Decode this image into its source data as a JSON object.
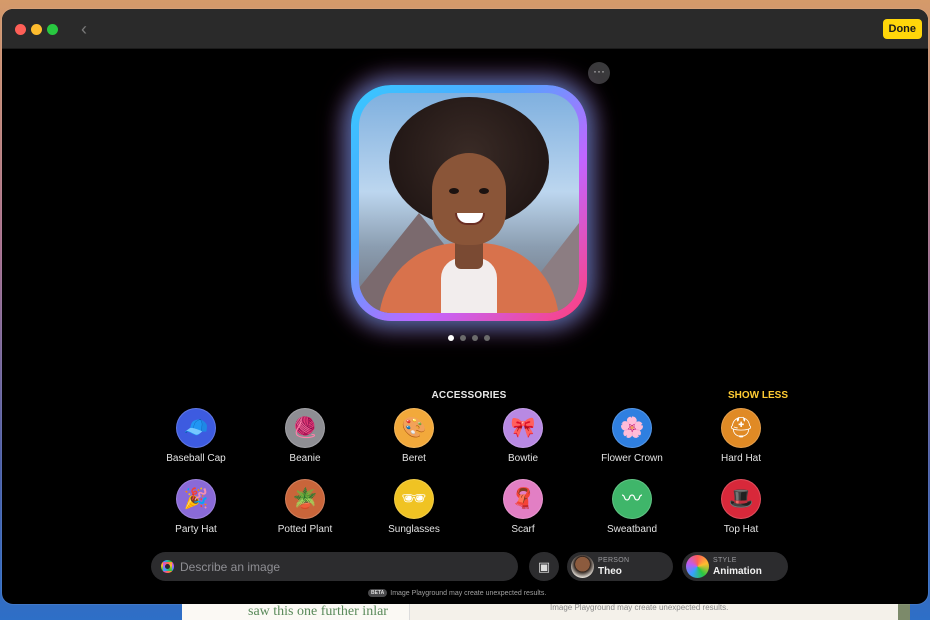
{
  "window": {
    "back_icon": "chevron-left-icon",
    "done_label": "Done",
    "more_icon": "ellipsis-icon",
    "more_label": "···"
  },
  "preview": {
    "page_count": 4,
    "active_page": 1
  },
  "accessories": {
    "title": "ACCESSORIES",
    "show_less_label": "SHOW LESS",
    "items": [
      {
        "label": "Baseball Cap",
        "icon": "baseball-cap-icon",
        "glyph": "🧢",
        "bg": "#3d5be0"
      },
      {
        "label": "Beanie",
        "icon": "beanie-icon",
        "glyph": "🧶",
        "bg": "#8e8e93"
      },
      {
        "label": "Beret",
        "icon": "beret-icon",
        "glyph": "🎨",
        "bg": "#f2a93b"
      },
      {
        "label": "Bowtie",
        "icon": "bowtie-icon",
        "glyph": "🎀",
        "bg": "#b889e3"
      },
      {
        "label": "Flower Crown",
        "icon": "flower-crown-icon",
        "glyph": "🌸",
        "bg": "#2f7fe0"
      },
      {
        "label": "Hard Hat",
        "icon": "hard-hat-icon",
        "glyph": "⛑",
        "bg": "#e08a25"
      },
      {
        "label": "Party Hat",
        "icon": "party-hat-icon",
        "glyph": "🎉",
        "bg": "#8a6ad8"
      },
      {
        "label": "Potted Plant",
        "icon": "potted-plant-icon",
        "glyph": "🪴",
        "bg": "#c9653a"
      },
      {
        "label": "Sunglasses",
        "icon": "sunglasses-icon",
        "glyph": "🕶",
        "bg": "#f0c323"
      },
      {
        "label": "Scarf",
        "icon": "scarf-icon",
        "glyph": "🧣",
        "bg": "#e27fc4"
      },
      {
        "label": "Sweatband",
        "icon": "sweatband-icon",
        "glyph": "〰",
        "bg": "#3fb66a"
      },
      {
        "label": "Top Hat",
        "icon": "top-hat-icon",
        "glyph": "🎩",
        "bg": "#d8283a"
      }
    ]
  },
  "prompt": {
    "placeholder": "Describe an image",
    "value": ""
  },
  "photo_button_icon": "photo-library-icon",
  "person": {
    "caption": "PERSON",
    "value": "Theo"
  },
  "style": {
    "caption": "STYLE",
    "value": "Animation"
  },
  "disclaimer": {
    "badge": "BETA",
    "text": "Image Playground may create unexpected results."
  },
  "background": {
    "doc_text": "saw this one further inlar",
    "doc_note": "Image Playground may create unexpected results."
  },
  "colors": {
    "accent_yellow": "#ffd60a",
    "show_less": "#ffcc33"
  }
}
